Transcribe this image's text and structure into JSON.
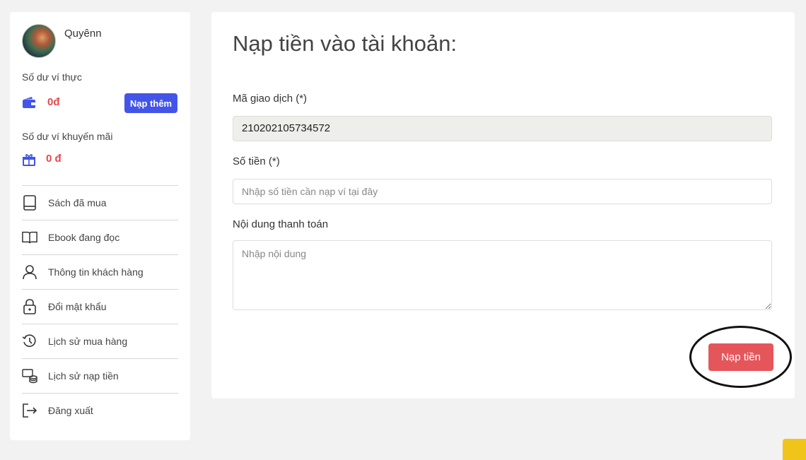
{
  "sidebar": {
    "username": "Quyênn",
    "wallet_label": "Số dư ví thực",
    "wallet_amount": "0đ",
    "topup_button": "Nạp thêm",
    "promo_label": "Số dư ví khuyến mãi",
    "promo_amount": "0 đ",
    "menu": [
      {
        "label": "Sách đã mua",
        "icon": "book-icon"
      },
      {
        "label": "Ebook đang đọc",
        "icon": "open-book-icon"
      },
      {
        "label": "Thông tin khách hàng",
        "icon": "user-icon"
      },
      {
        "label": "Đổi mật khẩu",
        "icon": "lock-icon"
      },
      {
        "label": "Lịch sử mua hàng",
        "icon": "history-icon"
      },
      {
        "label": "Lịch sử nạp tiền",
        "icon": "coins-icon"
      },
      {
        "label": "Đăng xuất",
        "icon": "logout-icon"
      }
    ]
  },
  "main": {
    "title": "Nạp tiền vào tài khoản:",
    "transaction_label": "Mã giao dịch (*)",
    "transaction_value": "210202105734572",
    "amount_label": "Số tiền (*)",
    "amount_placeholder": "Nhập số tiền cần nạp ví tại đây",
    "content_label": "Nội dung thanh toán",
    "content_placeholder": "Nhập nội dung",
    "submit_button": "Nạp tiền"
  },
  "colors": {
    "accent_blue": "#4255e8",
    "danger_red": "#e5484d",
    "submit_red": "#e5565b"
  }
}
